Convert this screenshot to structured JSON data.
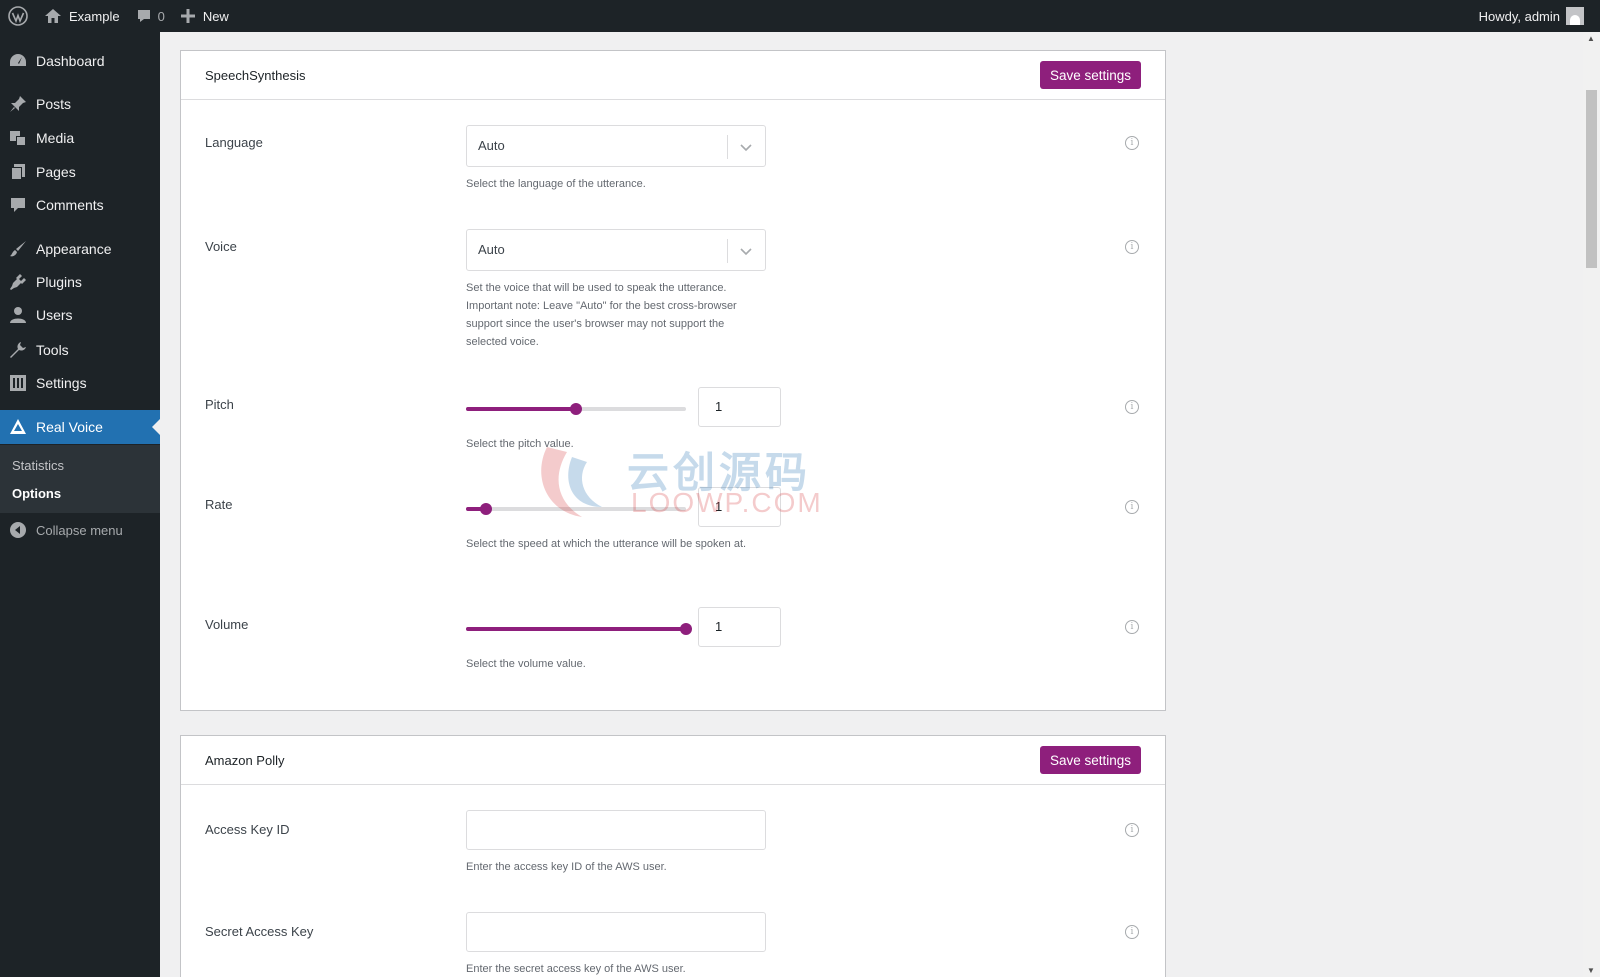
{
  "adminbar": {
    "site_name": "Example",
    "comments_count": "0",
    "new_label": "New",
    "howdy": "Howdy, admin"
  },
  "sidebar": {
    "items": [
      {
        "label": "Dashboard",
        "icon": "dashboard-icon"
      },
      {
        "label": "Posts",
        "icon": "pin-icon"
      },
      {
        "label": "Media",
        "icon": "media-icon"
      },
      {
        "label": "Pages",
        "icon": "pages-icon"
      },
      {
        "label": "Comments",
        "icon": "comment-icon"
      },
      {
        "label": "Appearance",
        "icon": "brush-icon"
      },
      {
        "label": "Plugins",
        "icon": "plug-icon"
      },
      {
        "label": "Users",
        "icon": "user-icon"
      },
      {
        "label": "Tools",
        "icon": "wrench-icon"
      },
      {
        "label": "Settings",
        "icon": "settings-icon"
      },
      {
        "label": "Real Voice",
        "icon": "triangle-icon"
      }
    ],
    "submenu": [
      {
        "label": "Statistics"
      },
      {
        "label": "Options"
      }
    ],
    "collapse_label": "Collapse menu",
    "current_color": "#2271b1"
  },
  "speech": {
    "title": "SpeechSynthesis",
    "save_label": "Save settings",
    "language": {
      "label": "Language",
      "value": "Auto",
      "desc": "Select the language of the utterance."
    },
    "voice": {
      "label": "Voice",
      "value": "Auto",
      "desc": "Set the voice that will be used to speak the utterance. Important note: Leave \"Auto\" for the best cross-browser support since the user's browser may not support the selected voice."
    },
    "pitch": {
      "label": "Pitch",
      "value": "1",
      "slider_fraction": 0.5,
      "desc": "Select the pitch value."
    },
    "rate": {
      "label": "Rate",
      "value": "1",
      "slider_fraction": 0.09,
      "desc": "Select the speed at which the utterance will be spoken at."
    },
    "volume": {
      "label": "Volume",
      "value": "1",
      "slider_fraction": 1.0,
      "desc": "Select the volume value."
    }
  },
  "polly": {
    "title": "Amazon Polly",
    "save_label": "Save settings",
    "access_key": {
      "label": "Access Key ID",
      "value": "",
      "desc": "Enter the access key ID of the AWS user."
    },
    "secret_key": {
      "label": "Secret Access Key",
      "value": "",
      "desc": "Enter the secret access key of the AWS user."
    }
  },
  "watermark": {
    "text": "云创源码",
    "sub": "LOOWP.COM"
  },
  "accent_color": "#8e1f7c"
}
